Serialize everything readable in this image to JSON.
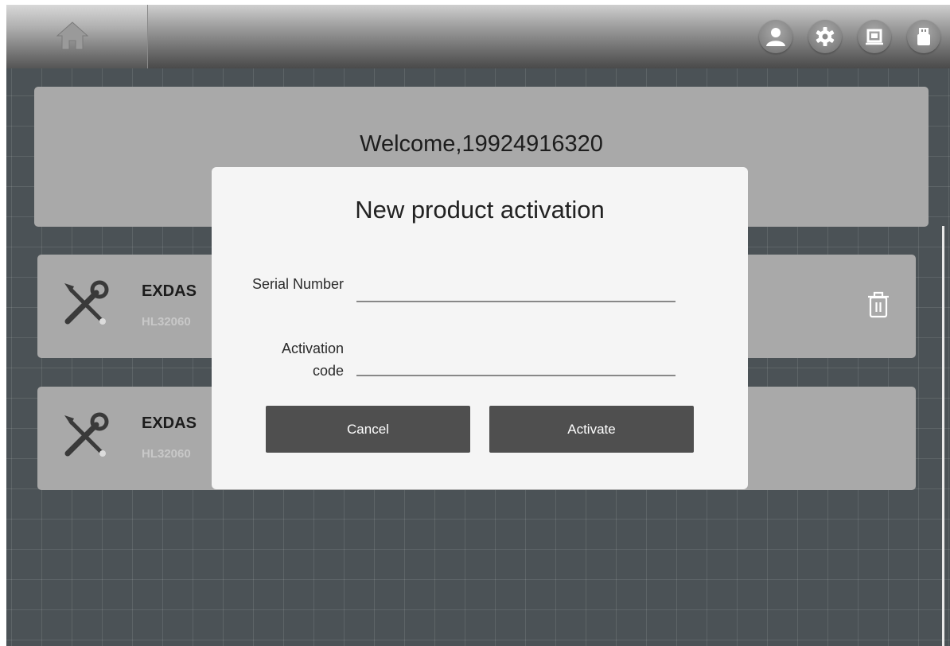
{
  "header": {
    "home_icon": "home-icon",
    "right_icons": [
      "user-icon",
      "gear-icon",
      "screenshot-icon",
      "usb-icon"
    ]
  },
  "welcome": {
    "text": "Welcome,19924916320"
  },
  "products": [
    {
      "name": "EXDAS",
      "serial": "HL32060",
      "icon": "tools-icon"
    },
    {
      "name": "EXDAS",
      "serial": "HL32060",
      "icon": "tools-icon"
    }
  ],
  "dialog": {
    "title": "New product activation",
    "serial_label": "Serial Number",
    "serial_value": "",
    "activation_label_line1": "Activation",
    "activation_label_line2": "code",
    "activation_value": "",
    "cancel_label": "Cancel",
    "activate_label": "Activate"
  },
  "colors": {
    "background": "#4b5256",
    "card": "#a9a9a9",
    "dialog": "#f5f5f5",
    "button": "#4f4f4f"
  }
}
